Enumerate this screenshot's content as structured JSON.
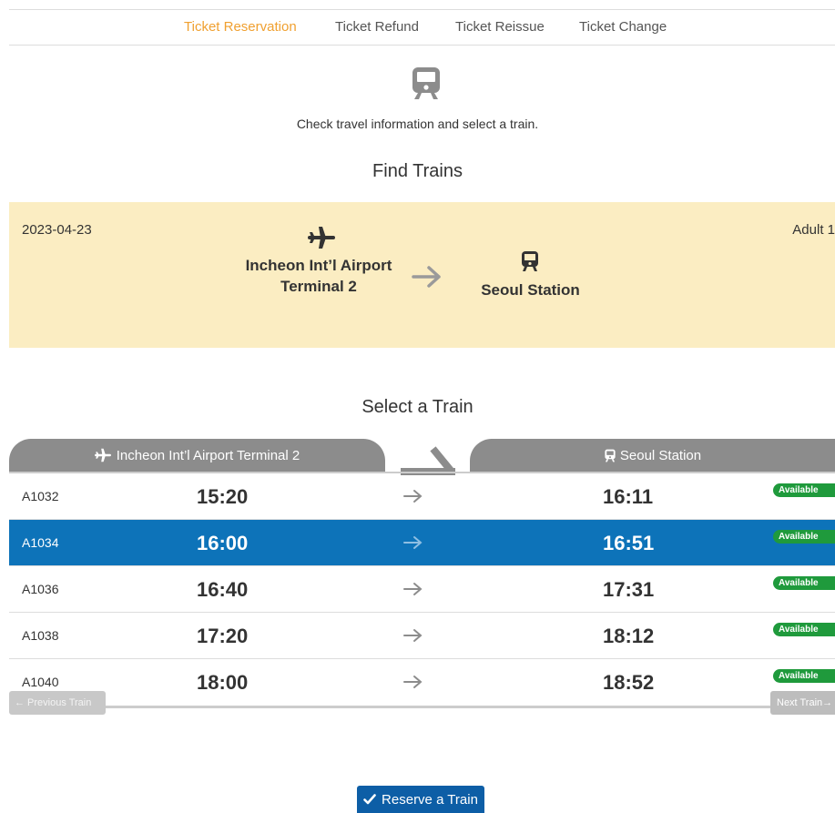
{
  "tabs": [
    {
      "label": "Ticket Reservation",
      "active": true
    },
    {
      "label": "Ticket Refund",
      "active": false
    },
    {
      "label": "Ticket Reissue",
      "active": false
    },
    {
      "label": "Ticket Change",
      "active": false
    }
  ],
  "intro": "Check travel information and select a train.",
  "find_title": "Find Trains",
  "search": {
    "date": "2023-04-23",
    "passengers": "Adult 1",
    "departure": "Incheon Int’l Airport Terminal 2",
    "arrival": "Seoul Station"
  },
  "select_title": "Select a Train",
  "table": {
    "departure_header": "Incheon Int’l Airport Terminal 2",
    "arrival_header": "Seoul Station",
    "rows": [
      {
        "code": "A1032",
        "dep": "15:20",
        "arr": "16:11",
        "status": "Available",
        "selected": false
      },
      {
        "code": "A1034",
        "dep": "16:00",
        "arr": "16:51",
        "status": "Available",
        "selected": true
      },
      {
        "code": "A1036",
        "dep": "16:40",
        "arr": "17:31",
        "status": "Available",
        "selected": false
      },
      {
        "code": "A1038",
        "dep": "17:20",
        "arr": "18:12",
        "status": "Available",
        "selected": false
      },
      {
        "code": "A1040",
        "dep": "18:00",
        "arr": "18:52",
        "status": "Available",
        "selected": false
      }
    ]
  },
  "buttons": {
    "prev": "← Previous Train",
    "next": "Next Train→",
    "reserve": "Reserve a Train"
  },
  "colors": {
    "accent_tab": "#f0a030",
    "selected_row": "#0d73b9",
    "search_bg": "#fbedc2",
    "available_badge": "#1f9a3c",
    "reserve_button": "#0d5ea6"
  },
  "icons": {
    "top": "train-icon",
    "departure": "airplane-icon",
    "arrival": "train-icon",
    "direction": "arrow-right-icon",
    "reserve": "checkmark-icon"
  }
}
